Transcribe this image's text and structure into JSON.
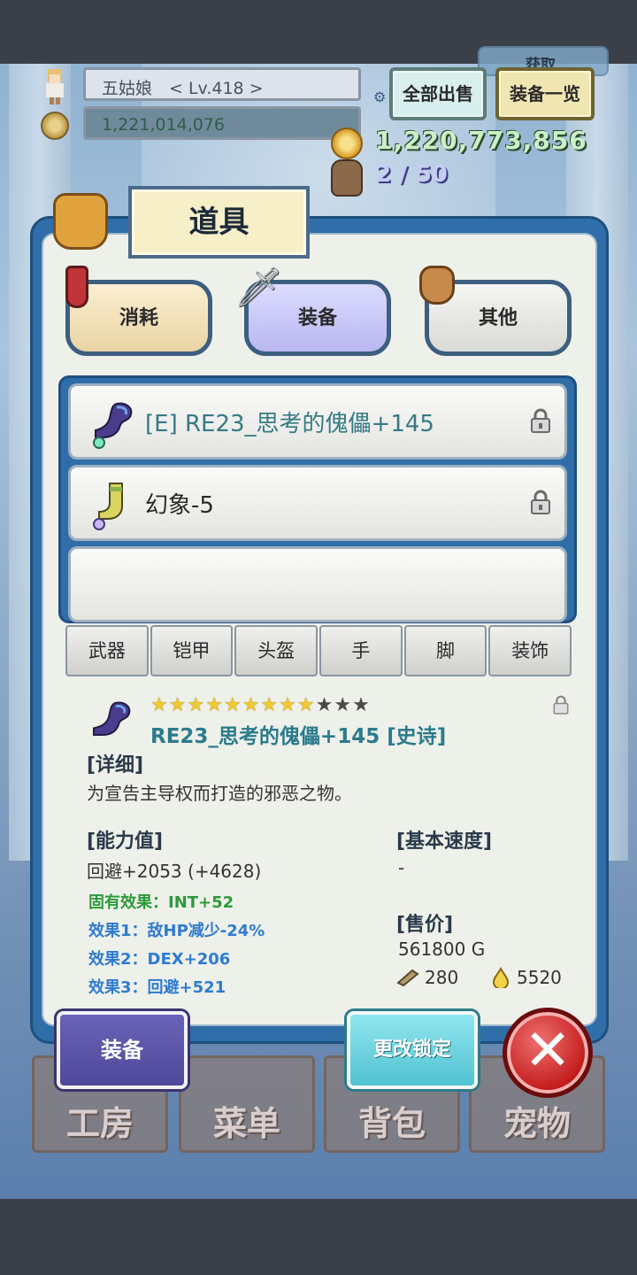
{
  "player": {
    "name_level": "五姑娘　< Lv.418 >",
    "gold_partial": "1,221,014,076",
    "rank_badge": "获取"
  },
  "top_buttons": {
    "sell_all": "全部出售",
    "equip_list": "装备一览"
  },
  "currency": {
    "gold": "1,220,773,856",
    "bag": "2 / 50"
  },
  "panel": {
    "title": "道具"
  },
  "categories": {
    "consume": "消耗",
    "equip": "装备",
    "other": "其他"
  },
  "items": [
    {
      "name": "[E] RE23_思考的傀儡+145",
      "icon": "purple-boots-icon",
      "locked": true
    },
    {
      "name": "幻象-5",
      "icon": "yellow-boots-icon",
      "locked": true
    }
  ],
  "filters": [
    "武器",
    "铠甲",
    "头盔",
    "手",
    "脚",
    "装饰"
  ],
  "detail": {
    "rating": 9,
    "max_rating": 12,
    "title": "RE23_思考的傀儡+145 [史诗]",
    "desc_header": "[详细]",
    "description": "为宣告主导权而打造的邪恶之物。",
    "stats_header": "[能力值]",
    "stat_main": "回避+2053 (+4628)",
    "effect_fixed": "固有效果：INT+52",
    "effect_1": "效果1：敌HP减少-24%",
    "effect_2": "效果2：DEX+206",
    "effect_3": "效果3：回避+521",
    "speed_header": "[基本速度]",
    "speed_value": "-",
    "price_header": "[售价]",
    "price_value": "561800 G",
    "mat_1": "280",
    "mat_2": "5520"
  },
  "actions": {
    "equip": "装备",
    "change_lock": "更改锁定",
    "close": "✕"
  },
  "bottom_nav": [
    "工房",
    "菜单",
    "背包",
    "宠物"
  ],
  "colors": {
    "panel_blue": "#2f6ea8",
    "item_teal": "#357a85",
    "effect_green": "#2e9a3a",
    "effect_blue": "#2e7bd0",
    "close_red": "#c21a1a"
  }
}
